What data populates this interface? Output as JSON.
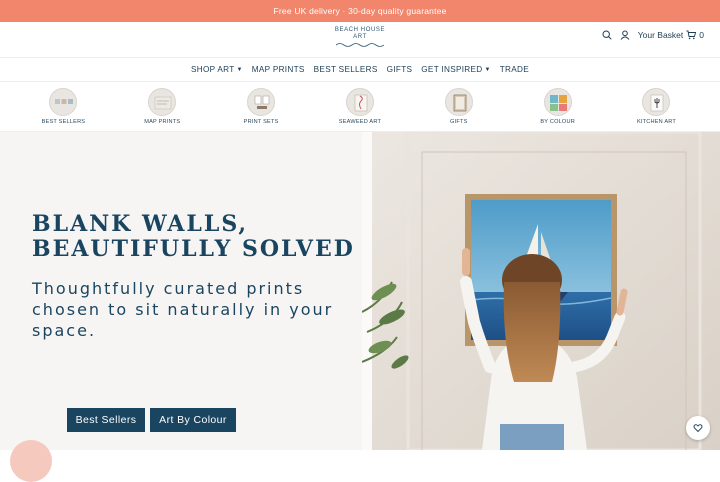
{
  "promo": {
    "text": "Free UK delivery · 30-day quality guarantee"
  },
  "header": {
    "logo_line1": "BEACH HOUSE",
    "logo_line2": "ART",
    "basket_label": "Your Basket",
    "basket_count": "0",
    "icons": [
      "search-icon",
      "account-icon",
      "basket-icon"
    ]
  },
  "nav": {
    "items": [
      {
        "label": "SHOP ART",
        "dropdown": true
      },
      {
        "label": "MAP PRINTS",
        "dropdown": false
      },
      {
        "label": "BEST SELLERS",
        "dropdown": false
      },
      {
        "label": "GIFTS",
        "dropdown": false
      },
      {
        "label": "GET INSPIRED",
        "dropdown": true
      },
      {
        "label": "TRADE",
        "dropdown": false
      }
    ]
  },
  "categories": [
    {
      "label": "BEST SELLERS"
    },
    {
      "label": "MAP PRINTS"
    },
    {
      "label": "PRINT SETS"
    },
    {
      "label": "SEAWEED ART"
    },
    {
      "label": "GIFTS"
    },
    {
      "label": "BY COLOUR"
    },
    {
      "label": "KITCHEN ART"
    }
  ],
  "hero": {
    "title_line1": "BLANK WALLS,",
    "title_line2": "BEAUTIFULLY SOLVED",
    "subtitle": "Thoughtfully curated prints chosen to sit naturally in your space.",
    "button1": "Best Sellers",
    "button2": "Art By Colour"
  },
  "colors": {
    "promo_bg": "#f2866d",
    "brand_navy": "#1a4560",
    "hero_bg": "#f7f5f3"
  }
}
